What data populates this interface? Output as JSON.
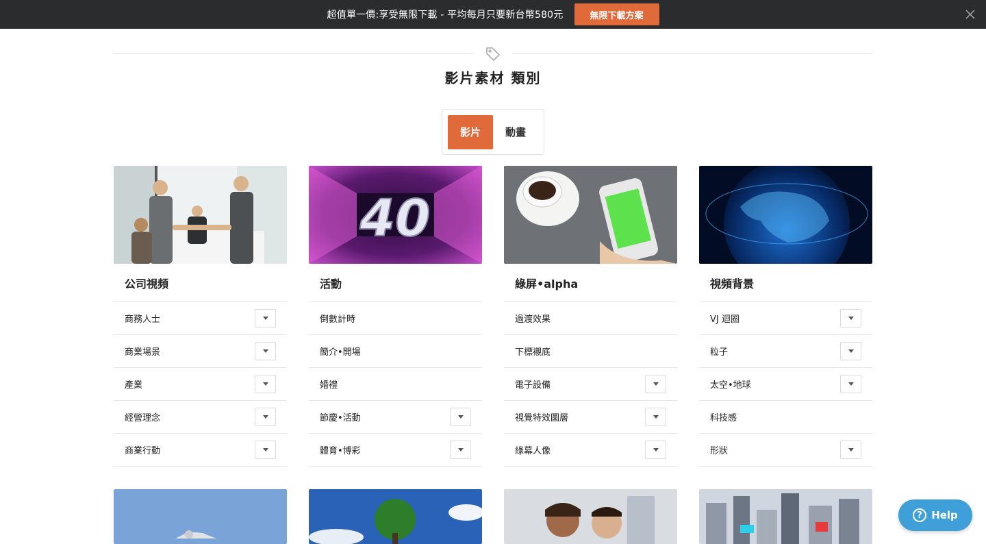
{
  "promo": {
    "text": "超值單一價:享受無限下載 - 平均每月只要新台幣580元",
    "button_label": "無限下載方案"
  },
  "title": "影片素材 類別",
  "tabs": [
    {
      "label": "影片",
      "active": true
    },
    {
      "label": "動畫",
      "active": false
    }
  ],
  "categories": [
    {
      "title": "公司視頻",
      "items": [
        {
          "label": "商務人士",
          "dropdown": true
        },
        {
          "label": "商業場景",
          "dropdown": true
        },
        {
          "label": "產業",
          "dropdown": true
        },
        {
          "label": "經營理念",
          "dropdown": true
        },
        {
          "label": "商業行動",
          "dropdown": true
        }
      ]
    },
    {
      "title": "活動",
      "image_text": "40",
      "items": [
        {
          "label": "倒數計時",
          "dropdown": false
        },
        {
          "label": "簡介•開場",
          "dropdown": false
        },
        {
          "label": "婚禮",
          "dropdown": false
        },
        {
          "label": "節慶•活動",
          "dropdown": true
        },
        {
          "label": "體育•博彩",
          "dropdown": true
        }
      ]
    },
    {
      "title": "綠屏•alpha",
      "items": [
        {
          "label": "過渡效果",
          "dropdown": false
        },
        {
          "label": "下標襯底",
          "dropdown": false
        },
        {
          "label": "電子設備",
          "dropdown": true
        },
        {
          "label": "視覺特效圖層",
          "dropdown": true
        },
        {
          "label": "綠幕人像",
          "dropdown": true
        }
      ]
    },
    {
      "title": "視頻背景",
      "items": [
        {
          "label": "VJ 迴圈",
          "dropdown": true
        },
        {
          "label": "粒子",
          "dropdown": true
        },
        {
          "label": "太空•地球",
          "dropdown": true
        },
        {
          "label": "科技感",
          "dropdown": false
        },
        {
          "label": "形狀",
          "dropdown": true
        }
      ]
    }
  ],
  "help": {
    "label": "Help",
    "icon_glyph": "?"
  },
  "colors": {
    "accent": "#e06a3a",
    "topbar": "#2b2c2e",
    "help": "#3f9fd8"
  }
}
